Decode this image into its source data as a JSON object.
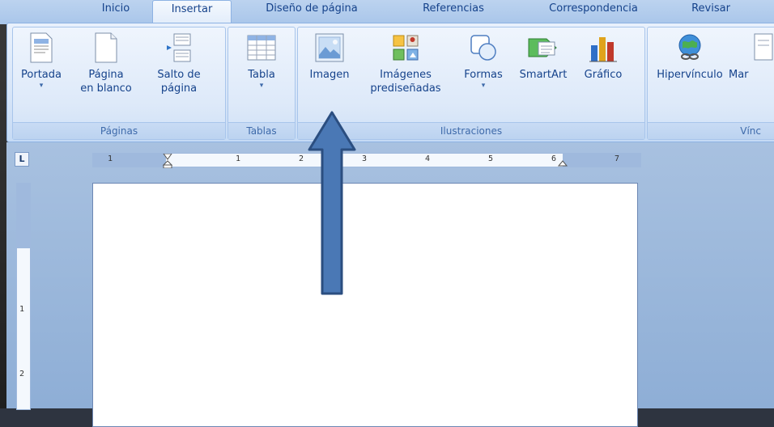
{
  "tabs": [
    {
      "label": "Inicio"
    },
    {
      "label": "Insertar"
    },
    {
      "label": "Diseño de página"
    },
    {
      "label": "Referencias"
    },
    {
      "label": "Correspondencia"
    },
    {
      "label": "Revisar"
    }
  ],
  "groups": {
    "paginas": {
      "label": "Páginas",
      "buttons": [
        {
          "label": "Portada",
          "icon": "cover-page-icon"
        },
        {
          "label": "Página\nen blanco",
          "icon": "blank-page-icon"
        },
        {
          "label": "Salto de\npágina",
          "icon": "page-break-icon"
        }
      ]
    },
    "tablas": {
      "label": "Tablas",
      "buttons": [
        {
          "label": "Tabla",
          "icon": "table-icon"
        }
      ]
    },
    "ilustraciones": {
      "label": "Ilustraciones",
      "buttons": [
        {
          "label": "Imagen",
          "icon": "picture-icon"
        },
        {
          "label": "Imágenes\nprediseñadas",
          "icon": "clip-art-icon"
        },
        {
          "label": "Formas",
          "icon": "shapes-icon"
        },
        {
          "label": "SmartArt",
          "icon": "smartart-icon"
        },
        {
          "label": "Gráfico",
          "icon": "chart-icon"
        }
      ]
    },
    "vinculos": {
      "label": "Vínc",
      "buttons": [
        {
          "label": "Hipervínculo",
          "icon": "hyperlink-icon"
        },
        {
          "label": "Mar",
          "icon": "bookmark-icon"
        }
      ]
    }
  },
  "ruler": {
    "h_numbers": [
      "1",
      "1",
      "2",
      "3",
      "4",
      "5",
      "6",
      "7"
    ],
    "v_numbers": [
      "1",
      "2"
    ],
    "corner": "L"
  },
  "colors": {
    "ribbon_text": "#15428b",
    "group_label": "#3e6aaa",
    "arrow_fill": "#4a78b5",
    "arrow_stroke": "#2b4e80"
  }
}
